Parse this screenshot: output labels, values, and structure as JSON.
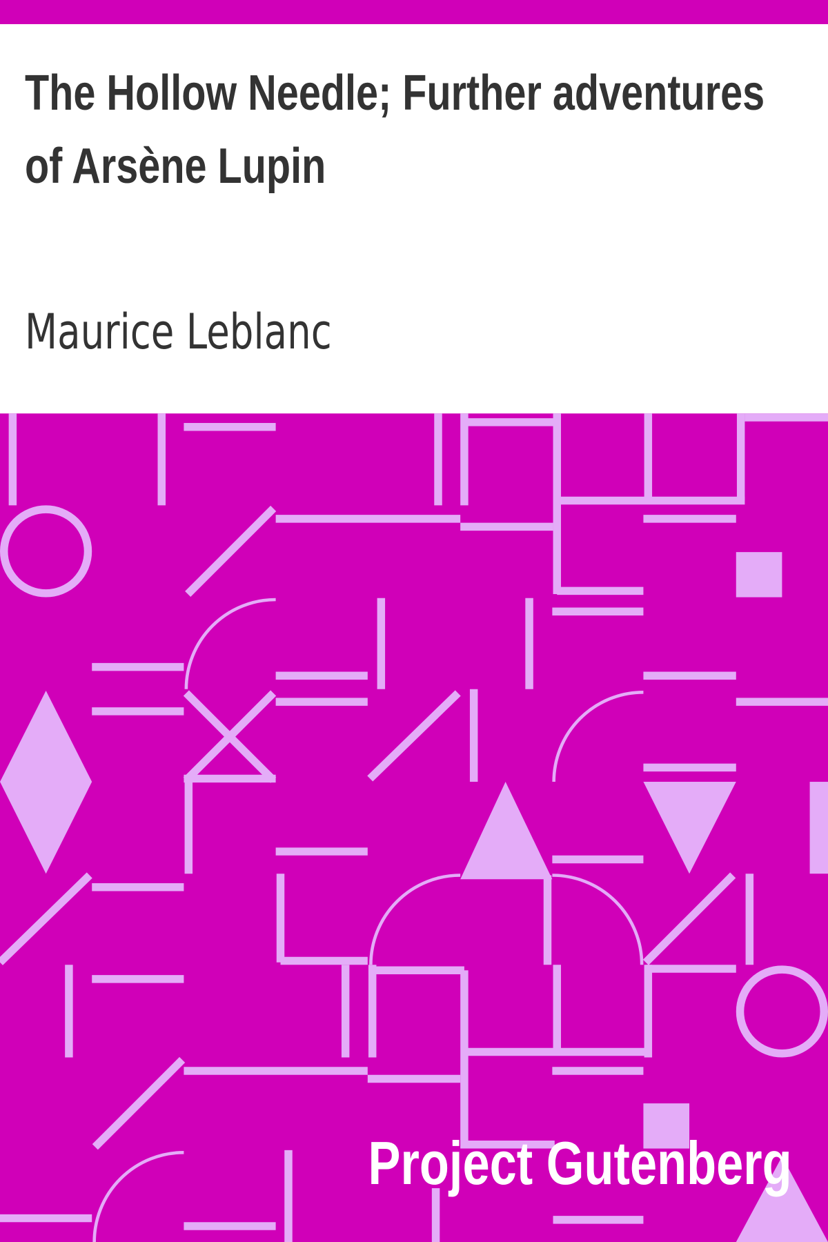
{
  "cover": {
    "title": "The Hollow Needle; Further adventures of Arsène Lupin",
    "author": "Maurice Leblanc",
    "publisher": "Project Gutenberg"
  },
  "colors": {
    "accent": "#d000b8",
    "pattern": "#e4acf8",
    "text": "#333333",
    "background": "#ffffff"
  }
}
